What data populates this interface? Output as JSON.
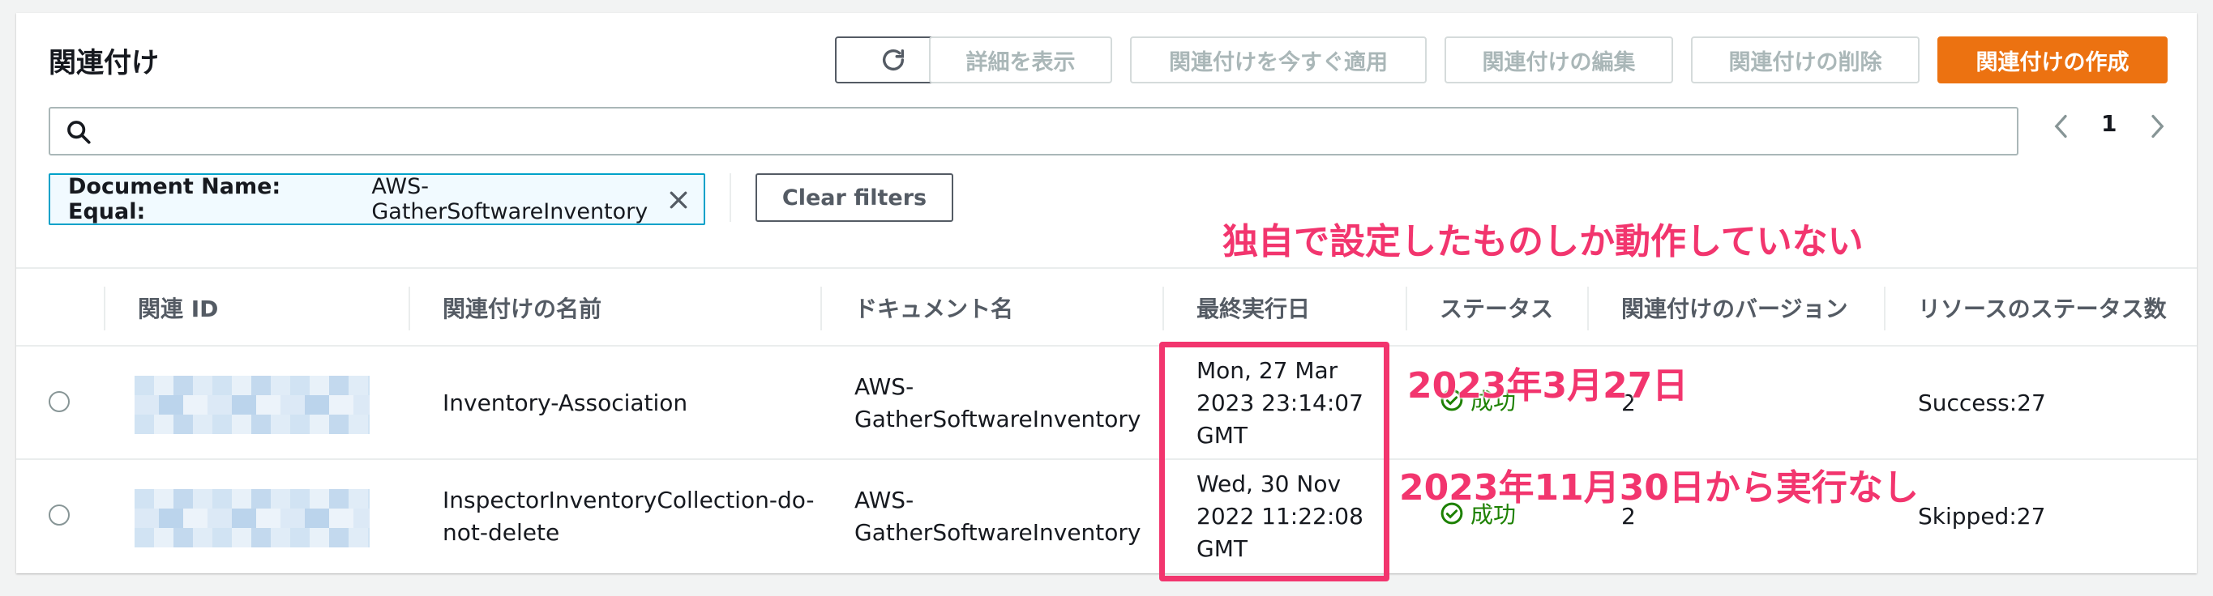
{
  "header": {
    "title": "関連付け",
    "buttons": {
      "details": "詳細を表示",
      "apply_now": "関連付けを今すぐ適用",
      "edit": "関連付けの編集",
      "delete": "関連付けの削除",
      "create": "関連付けの作成"
    }
  },
  "search": {
    "placeholder": ""
  },
  "pagination": {
    "current_page": "1"
  },
  "filter": {
    "key": "Document Name: Equal:",
    "value": "AWS-GatherSoftwareInventory",
    "clear_label": "Clear filters"
  },
  "annotations": {
    "note1": "独自で設定したものしか動作していない",
    "note2": "2023年3月27日",
    "note3": "2023年11月30日から実行なし"
  },
  "table": {
    "columns": [
      "関連 ID",
      "関連付けの名前",
      "ドキュメント名",
      "最終実行日",
      "ステータス",
      "関連付けのバージョン",
      "リソースのステータス数"
    ],
    "rows": [
      {
        "name": "Inventory-Association",
        "document": [
          "AWS-",
          "GatherSoftwareInventory"
        ],
        "last_run": [
          "Mon, 27 Mar",
          "2023 23:14:07",
          "GMT"
        ],
        "status": "成功",
        "version": "2",
        "resource_status": "Success:27"
      },
      {
        "name": [
          "InspectorInventoryCollection-do-",
          "not-delete"
        ],
        "document": [
          "AWS-",
          "GatherSoftwareInventory"
        ],
        "last_run": [
          "Wed, 30 Nov",
          "2022 11:22:08",
          "GMT"
        ],
        "status": "成功",
        "version": "2",
        "resource_status": "Skipped:27"
      }
    ]
  },
  "colors": {
    "primary": "#ec7211",
    "success": "#1d8102",
    "annotation": "#f2356e",
    "filter_border": "#00a1c9"
  },
  "icons": [
    "refresh-icon",
    "search-icon",
    "chevron-left-icon",
    "chevron-right-icon",
    "close-icon",
    "check-circle-icon"
  ]
}
